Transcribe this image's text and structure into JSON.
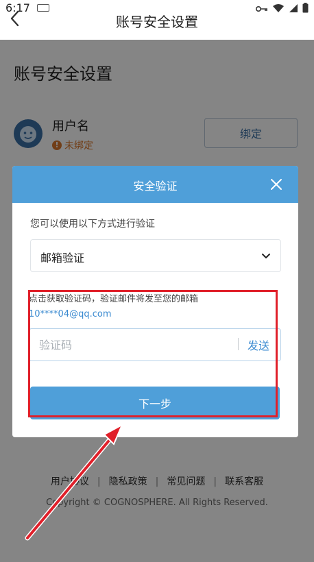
{
  "status_bar": {
    "time": "6:17"
  },
  "nav": {
    "title": "账号安全设置"
  },
  "page": {
    "heading": "账号安全设置",
    "account": {
      "label": "用户名",
      "status": "未绑定",
      "bind_label": "绑定"
    },
    "footer_links": [
      "用户协议",
      "隐私政策",
      "常见问题",
      "联系客服"
    ],
    "copyright": "Copyright © COGNOSPHERE. All Rights Reserved."
  },
  "modal": {
    "title": "安全验证",
    "hint": "您可以使用以下方式进行验证",
    "method": "邮箱验证",
    "code_info": "点击获取验证码，验证邮件将发至您的邮箱",
    "email": "10****04@qq.com",
    "code_placeholder": "验证码",
    "send_label": "发送",
    "next_label": "下一步"
  },
  "colors": {
    "accent": "#4f9fd9",
    "warning": "#d9772c",
    "highlight": "#e0202a"
  }
}
